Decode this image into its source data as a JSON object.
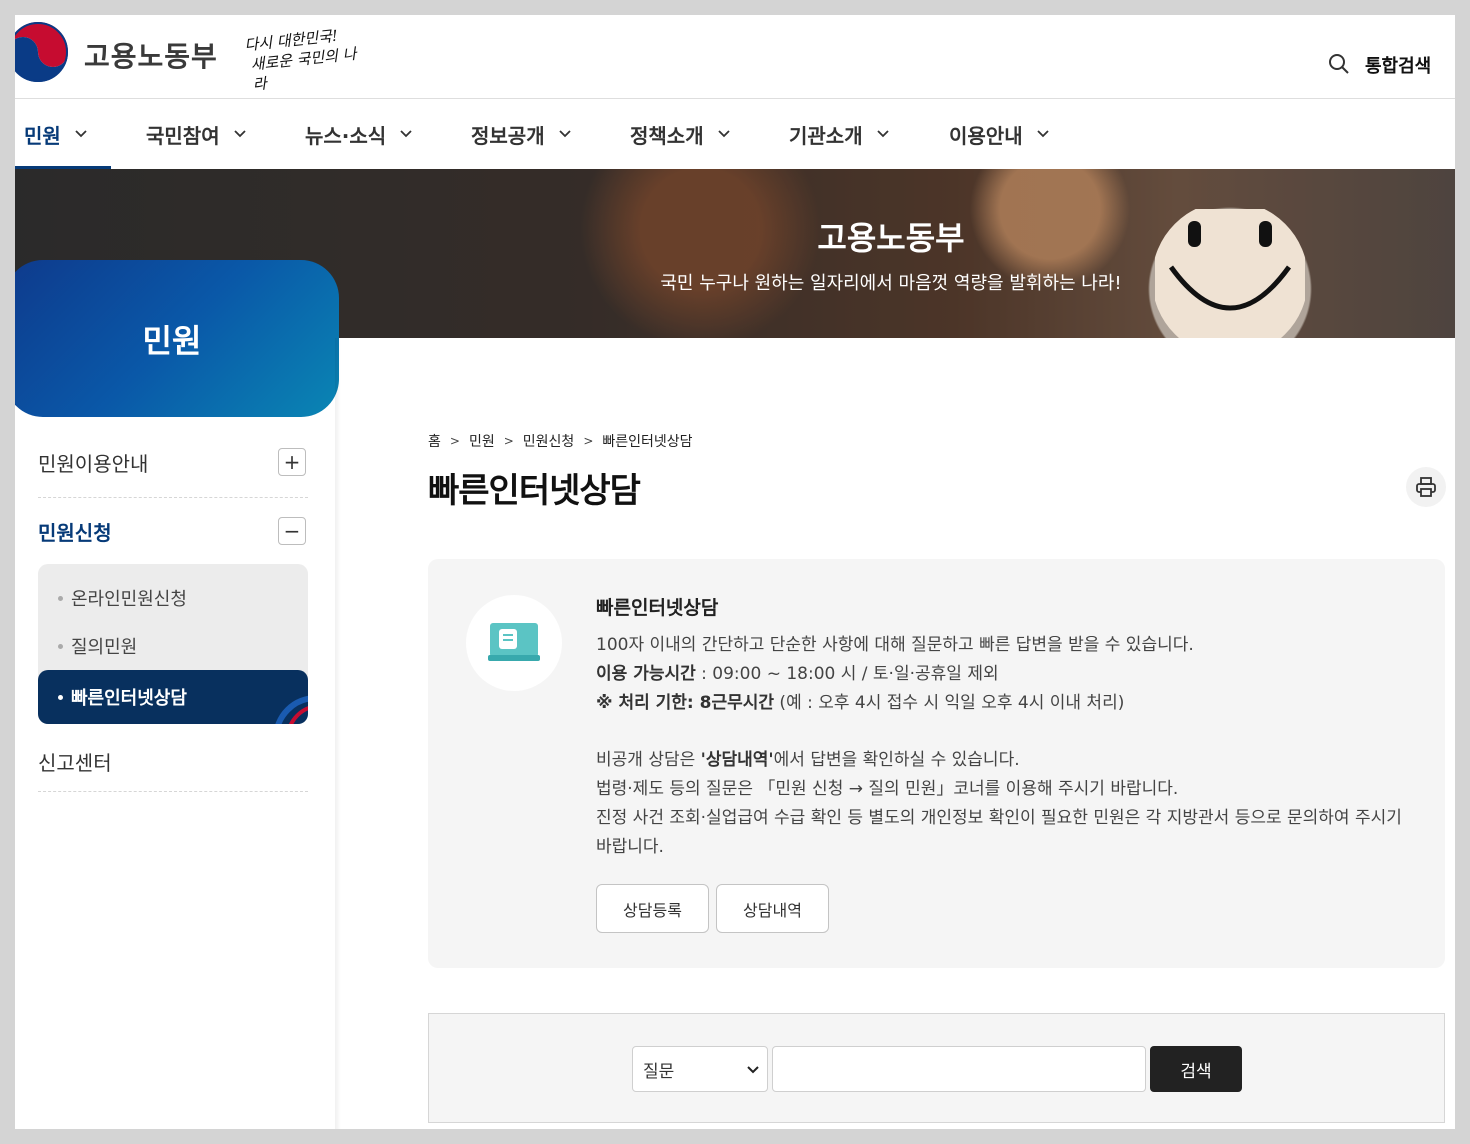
{
  "header": {
    "brand": "고용노동부",
    "slogan_line1": "다시 대한민국!",
    "slogan_line2": "새로운 국민의 나라",
    "unified_search": "통합검색"
  },
  "gnb": [
    {
      "label": "민원",
      "active": true
    },
    {
      "label": "국민참여"
    },
    {
      "label": "뉴스·소식"
    },
    {
      "label": "정보공개"
    },
    {
      "label": "정책소개"
    },
    {
      "label": "기관소개"
    },
    {
      "label": "이용안내"
    }
  ],
  "banner": {
    "title": "고용노동부",
    "subtitle": "국민 누구나 원하는 일자리에서 마음껏 역량을 발휘하는 나라!"
  },
  "side": {
    "title": "민원",
    "items": [
      {
        "label": "민원이용안내",
        "toggle": "+"
      },
      {
        "label": "민원신청",
        "toggle": "−"
      },
      {
        "label": "신고센터"
      }
    ],
    "sub_items": [
      "온라인민원신청",
      "질의민원",
      "빠른인터넷상담"
    ]
  },
  "breadcrumb": [
    "홈",
    "민원",
    "민원신청",
    "빠른인터넷상담"
  ],
  "page_title": "빠른인터넷상담",
  "info": {
    "title": "빠른인터넷상담",
    "desc": "100자 이내의 간단하고 단순한 사항에 대해 질문하고 빠른 답변을 받을 수 있습니다.",
    "hours_label": "이용 가능시간",
    "hours_value": " : 09:00 ~ 18:00 시 / 토·일·공휴일 제외",
    "deadline_label": "※ 처리 기한: 8근무시간",
    "deadline_value": " (예 : 오후 4시 접수 시 익일 오후 4시 이내 처리)",
    "private_pre": "비공개 상담은 ",
    "private_bold": "'상담내역'",
    "private_post": "에서 답변을 확인하실 수 있습니다.",
    "law_note": "법령·제도 등의 질문은 「민원 신청 → 질의 민원」코너를 이용해 주시기 바랍니다.",
    "case_note": "진정 사건 조회·실업급여 수급 확인 등 별도의 개인정보 확인이 필요한 민원은 각 지방관서 등으로 문의하여 주시기 바랍니다.",
    "btn_register": "상담등록",
    "btn_history": "상담내역"
  },
  "search": {
    "select_value": "질문",
    "keyword": "",
    "button": "검색"
  }
}
